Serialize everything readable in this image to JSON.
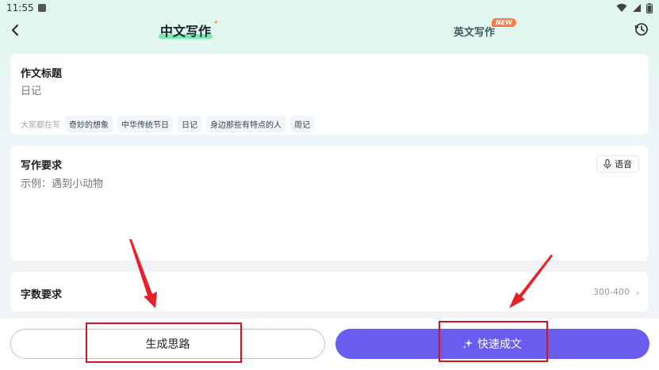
{
  "status_bar": {
    "time": "11:55"
  },
  "header": {
    "tab_chinese": "中文写作",
    "tab_english": "英文写作",
    "new_badge": "NEW"
  },
  "title_card": {
    "label": "作文标题",
    "placeholder": "日记",
    "trending_label": "大家都在写",
    "chips": [
      "奇妙的想象",
      "中华传统节日",
      "日记",
      "身边那些有特点的人",
      "周记"
    ]
  },
  "requirements_card": {
    "label": "写作要求",
    "placeholder": "示例：遇到小动物",
    "voice_label": "语音"
  },
  "word_count_card": {
    "label": "字数要求",
    "value": "300-400"
  },
  "bottom": {
    "generate_ideas_label": "生成思路",
    "quick_write_label": "快速成文"
  },
  "colors": {
    "accent": "#6b5cf0",
    "annotation": "#d8121c",
    "new_badge": "#ff7a45"
  }
}
